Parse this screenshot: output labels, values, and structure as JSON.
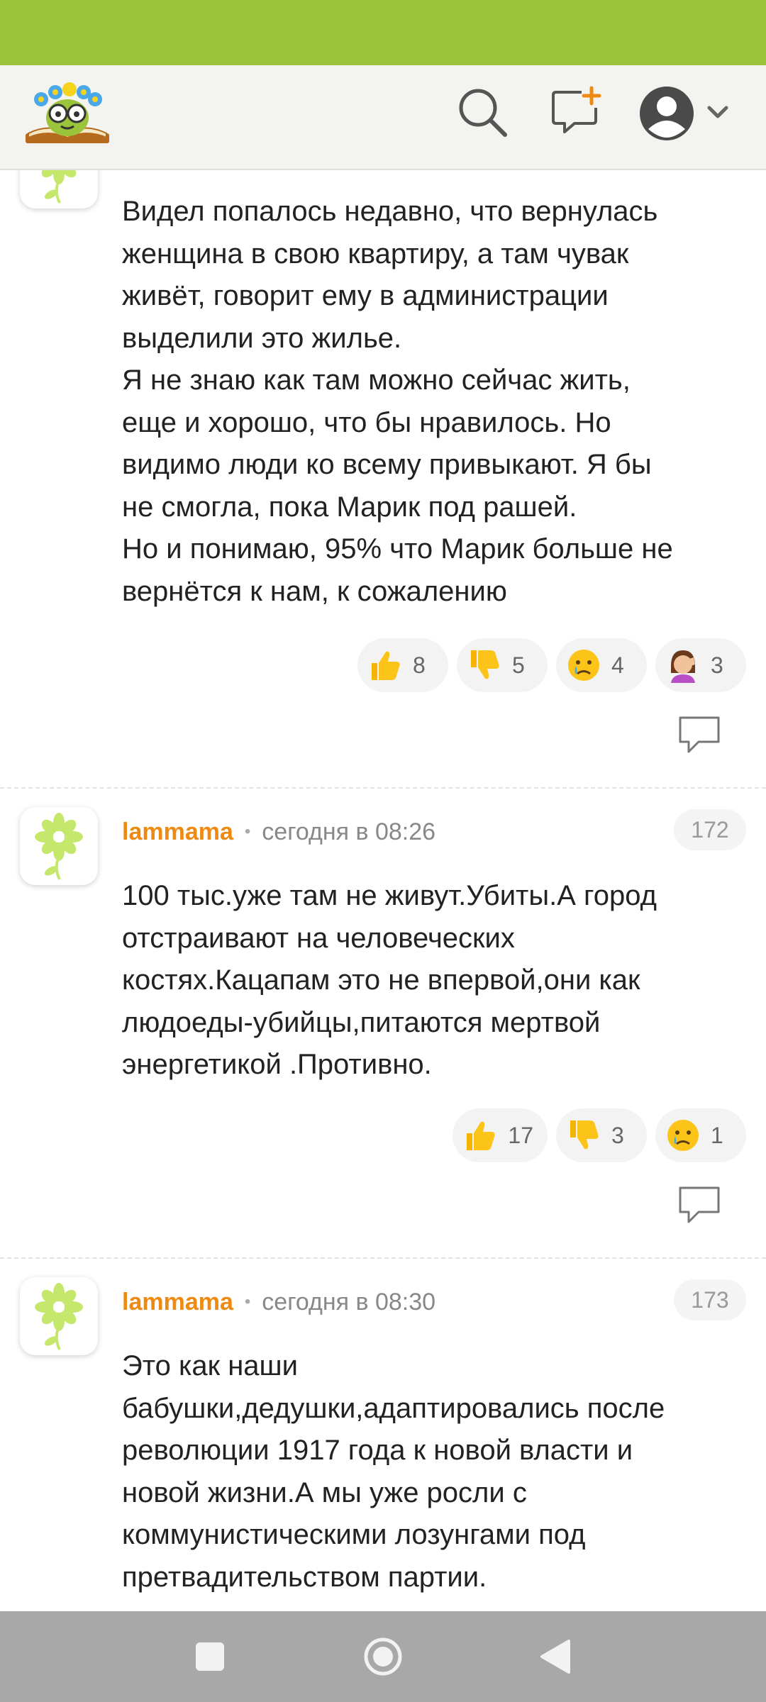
{
  "header": {
    "logo_icon": "smiling-book-flower-crown-logo",
    "search_icon": "search-icon",
    "new_post_icon": "new-message-plus-icon",
    "profile_icon": "user-avatar-icon",
    "chevron_icon": "chevron-down-icon",
    "accent_color": "#9bc43c"
  },
  "comments": [
    {
      "text_lines": [
        "Видел попалось недавно, что вернулась",
        "женщина в свою квартиру, а там чувак",
        "живёт, говорит ему в администрации",
        "выделили это жилье.",
        "Я не знаю как там можно сейчас жить,",
        "еще и хорошо, что бы нравилось. Но",
        "видимо люди ко всему привыкают. Я бы",
        "не смогла, пока Марик под рашей.",
        "Но и понимаю, 95% что Марик больше не",
        "вернётся к нам, к сожалению"
      ],
      "reactions": [
        {
          "emoji": "thumbs-up",
          "count": "8"
        },
        {
          "emoji": "thumbs-down",
          "count": "5"
        },
        {
          "emoji": "crying-face",
          "count": "4"
        },
        {
          "emoji": "woman-facepalming",
          "count": "3"
        }
      ]
    },
    {
      "author": "lammama",
      "time": "сегодня в 08:26",
      "number": "172",
      "text_lines": [
        "100 тыс.уже там не живут.Убиты.А город",
        "отстраивают на человеческих",
        "костях.Кацапам это не впервой,они как",
        "людоеды-убийцы,питаются мертвой",
        "энергетикой .Противно."
      ],
      "reactions": [
        {
          "emoji": "thumbs-up",
          "count": "17"
        },
        {
          "emoji": "thumbs-down",
          "count": "3"
        },
        {
          "emoji": "crying-face",
          "count": "1"
        }
      ]
    },
    {
      "author": "lammama",
      "time": "сегодня в 08:30",
      "number": "173",
      "text_lines": [
        "Это как наши",
        "бабушки,дедушки,адаптировались после",
        "революции 1917 года к новой власти и",
        "новой жизни.А мы уже росли с",
        "коммунистическими лозунгами под",
        "претвадительством партии."
      ]
    }
  ],
  "navbar": {
    "recents_icon": "recents-square-icon",
    "home_icon": "home-circle-icon",
    "back_icon": "back-triangle-icon"
  }
}
